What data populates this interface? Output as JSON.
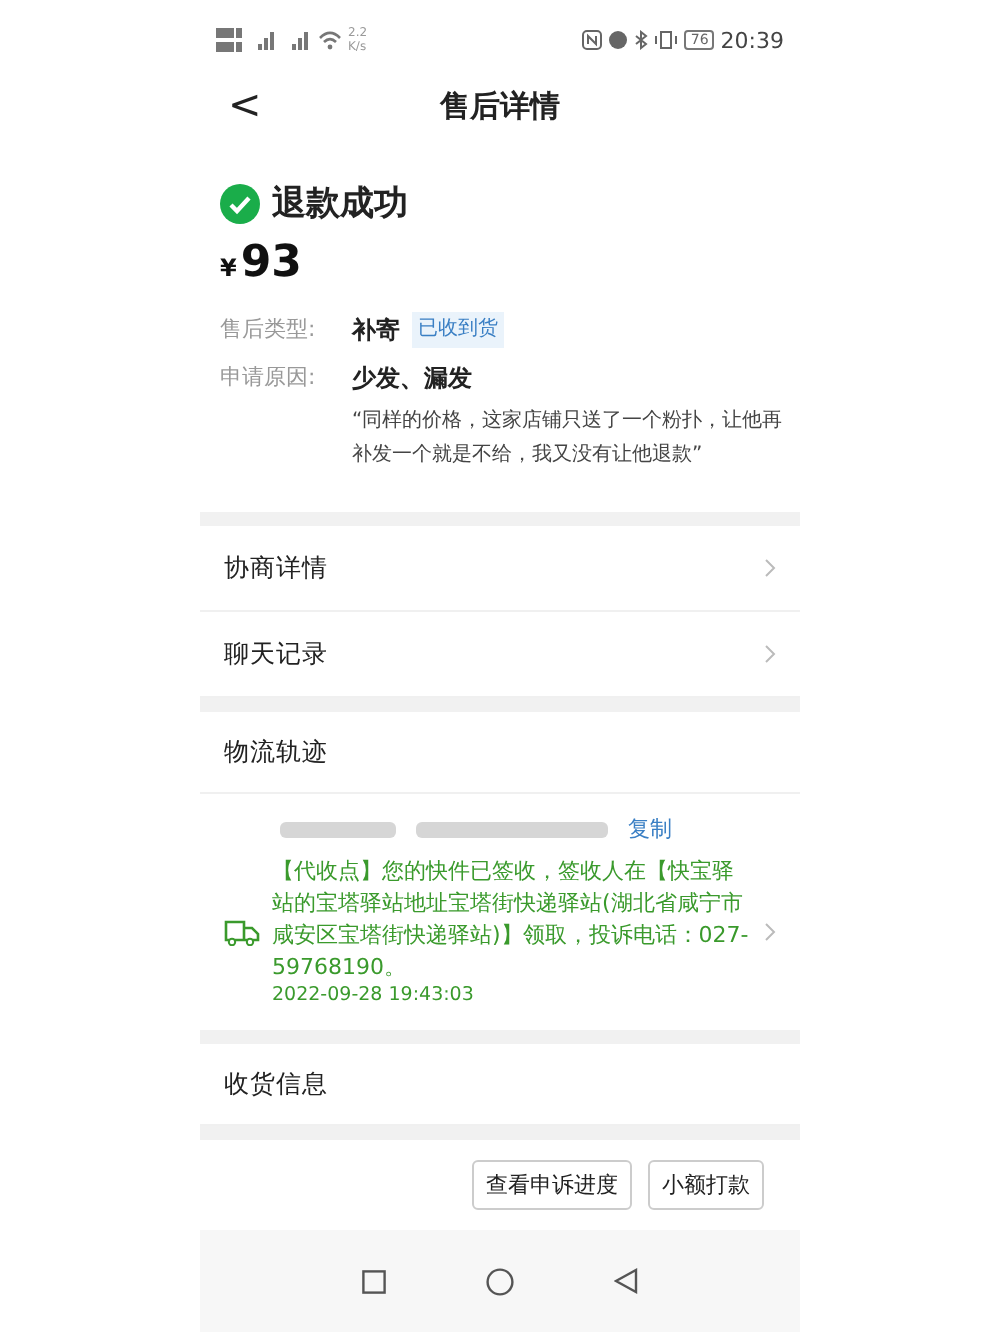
{
  "status_bar": {
    "speed": "2.2",
    "speed_unit": "K/s",
    "battery": "76",
    "time": "20:39"
  },
  "header": {
    "back": "<",
    "title": "售后详情"
  },
  "refund": {
    "status": "退款成功",
    "currency": "¥",
    "amount": "93"
  },
  "details": [
    {
      "label": "售后类型:",
      "value": "补寄",
      "tag": "已收到货"
    },
    {
      "label": "申请原因:",
      "value": "少发、漏发",
      "note": "“同样的价格，这家店铺只送了一个粉扑，让他再补发一个就是不给，我又没有让他退款”"
    }
  ],
  "links": [
    {
      "label": "协商详情"
    },
    {
      "label": "聊天记录"
    }
  ],
  "logistics": {
    "title": "物流轨迹",
    "copy": "复制",
    "message": "【代收点】您的快件已签收，签收人在【快宝驿站的宝塔驿站地址宝塔街快递驿站(湖北省咸宁市咸安区宝塔街快递驿站)】领取，投诉电话：027-59768190。",
    "time": "2022-09-28 19:43:03"
  },
  "receipt": {
    "label": "收货信息"
  },
  "buttons": [
    "查看申诉进度",
    "小额打款"
  ]
}
